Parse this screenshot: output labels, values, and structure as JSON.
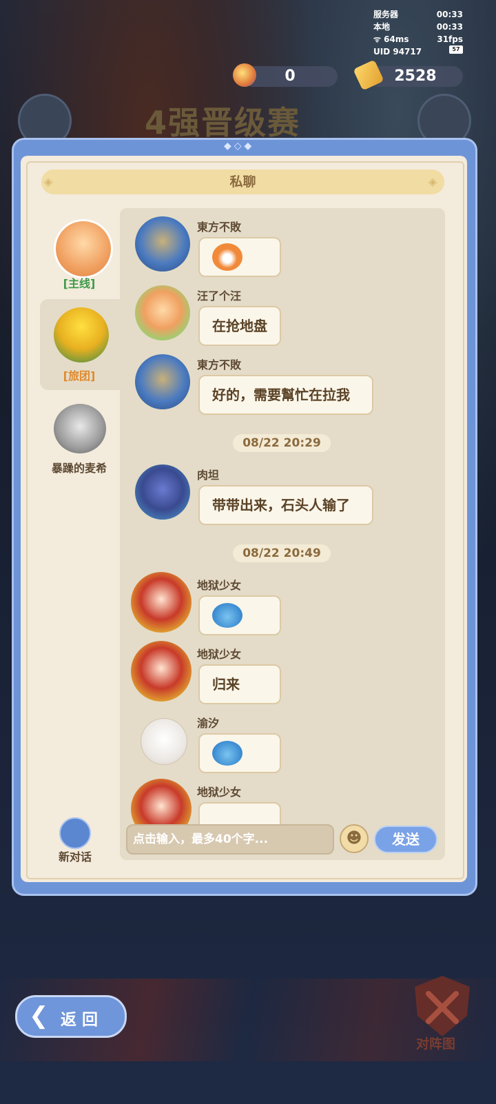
{
  "status": {
    "server_label": "服务器",
    "server_time": "00:33",
    "local_label": "本地",
    "local_time": "00:33",
    "ping": "64ms",
    "fps": "31fps",
    "uid": "UID 94717",
    "battery": "57"
  },
  "currency": {
    "gems": "0",
    "coins": "2528"
  },
  "background_title": "4强晋级赛",
  "panel": {
    "title": "私聊"
  },
  "sidebar": {
    "items": [
      {
        "label": "[主线]",
        "color": "#3e9a4a"
      },
      {
        "label": "[旅团]",
        "color": "#e08a2e"
      },
      {
        "label": "暴躁的麦希",
        "color": "#5e4a34"
      }
    ],
    "new_chat_label": "新对话"
  },
  "messages": [
    {
      "name": "東方不敗",
      "text": ""
    },
    {
      "name": "汪了个汪",
      "text": "在抢地盘"
    },
    {
      "name": "東方不敗",
      "text": "好的，需要幫忙在拉我"
    },
    {
      "name": "肉坦",
      "text": "带带出来，石头人输了"
    },
    {
      "name": "地狱少女",
      "text": ""
    },
    {
      "name": "地狱少女",
      "text": "归来"
    },
    {
      "name": "渝汐",
      "text": ""
    },
    {
      "name": "地狱少女",
      "text": ""
    }
  ],
  "timestamps": [
    "08/22 20:29",
    "08/22 20:49"
  ],
  "input": {
    "placeholder": "点击输入，最多40个字..."
  },
  "send_label": "发送",
  "back_label": "返回",
  "formation_label": "对阵图",
  "colors": {
    "panel_blue": "#6e94d8",
    "panel_cream": "#f3ebdc",
    "title_gold": "#f1dca3"
  }
}
